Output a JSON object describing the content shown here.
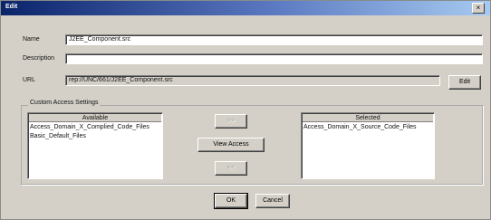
{
  "window": {
    "title": "Edit",
    "close_glyph": "×"
  },
  "form": {
    "name_label": "Name",
    "name_value": "J2EE_Component.src",
    "description_label": "Description",
    "description_value": "",
    "url_label": "URL",
    "url_value": "rep://UNC/661/J2EE_Component.src",
    "edit_button": "Edit"
  },
  "access": {
    "group_title": "Custom Access Settings",
    "available_header": "Available",
    "available_items": [
      "Access_Domain_X_Complied_Code_Files",
      "Basic_Default_Files"
    ],
    "selected_header": "Selected",
    "selected_items": [
      "Access_Domain_X_Source_Code_Files"
    ],
    "add_button": ">>",
    "view_access_button": "View Access",
    "remove_button": "<<"
  },
  "footer": {
    "ok_button": "OK",
    "cancel_button": "Cancel"
  }
}
